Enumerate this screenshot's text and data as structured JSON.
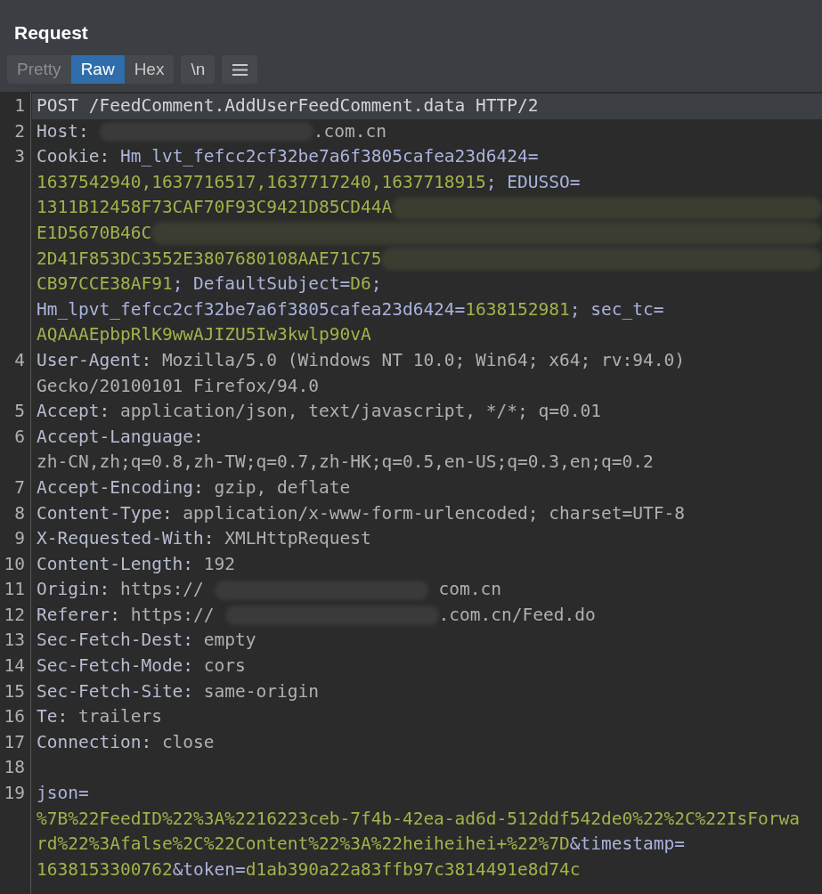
{
  "panel": {
    "title": "Request"
  },
  "tabs": [
    {
      "label": "Pretty",
      "selected": false,
      "disabled": true
    },
    {
      "label": "Raw",
      "selected": true,
      "disabled": false
    },
    {
      "label": "Hex",
      "selected": false,
      "disabled": false
    }
  ],
  "newline_toggle": {
    "label": "\\n"
  },
  "lines": [
    {
      "number": "1",
      "selected": true,
      "rows": [
        {
          "spans": [
            {
              "kind": "plain",
              "text": "POST /FeedComment.AddUserFeedComment.data HTTP/2"
            }
          ]
        }
      ]
    },
    {
      "number": "2",
      "selected": false,
      "rows": [
        {
          "spans": [
            {
              "kind": "name",
              "text": "Host:"
            },
            {
              "kind": "mask"
            },
            {
              "kind": "value",
              "text": ".com.cn"
            }
          ]
        }
      ]
    },
    {
      "number": "3",
      "selected": false,
      "rows": [
        {
          "spans": [
            {
              "kind": "name",
              "text": "Cookie:"
            },
            {
              "kind": "key",
              "text": " Hm_lvt_fefcc2cf32be7a6f3805cafea23d6424="
            }
          ]
        },
        {
          "spans": [
            {
              "kind": "green",
              "text": "1637542940,1637716517,1637717240,1637718915"
            },
            {
              "kind": "key",
              "text": "; EDUSSO="
            }
          ]
        },
        {
          "spans": [
            {
              "kind": "green",
              "text": "1311B12458F73CAF70F93C9421D85CD44A"
            },
            {
              "kind": "mask_wide"
            }
          ]
        },
        {
          "spans": [
            {
              "kind": "green",
              "text": "E1D5670B46C"
            },
            {
              "kind": "mask_wide"
            }
          ]
        },
        {
          "spans": [
            {
              "kind": "green",
              "text": "2D41F853DC3552E3807680108AAE71C75"
            },
            {
              "kind": "mask_wide"
            }
          ]
        },
        {
          "spans": [
            {
              "kind": "green",
              "text": "CB97CCE38AF91"
            },
            {
              "kind": "key",
              "text": "; DefaultSubject="
            },
            {
              "kind": "green",
              "text": "D6"
            },
            {
              "kind": "key",
              "text": ";"
            }
          ]
        },
        {
          "spans": [
            {
              "kind": "key",
              "text": "Hm_lpvt_fefcc2cf32be7a6f3805cafea23d6424="
            },
            {
              "kind": "green",
              "text": "1638152981"
            },
            {
              "kind": "key",
              "text": "; sec_tc="
            }
          ]
        },
        {
          "spans": [
            {
              "kind": "green",
              "text": "AQAAAEpbpRlK9wwAJIZU5Iw3kwlp90vA"
            }
          ]
        }
      ]
    },
    {
      "number": "4",
      "selected": false,
      "rows": [
        {
          "spans": [
            {
              "kind": "name",
              "text": "User-Agent:"
            },
            {
              "kind": "value",
              "text": " Mozilla/5.0 (Windows NT 10.0; Win64; x64; rv:94.0)"
            }
          ]
        },
        {
          "spans": [
            {
              "kind": "value",
              "text": "Gecko/20100101 Firefox/94.0"
            }
          ]
        }
      ]
    },
    {
      "number": "5",
      "selected": false,
      "rows": [
        {
          "spans": [
            {
              "kind": "name",
              "text": "Accept:"
            },
            {
              "kind": "value",
              "text": " application/json, text/javascript, */*; q=0.01"
            }
          ]
        }
      ]
    },
    {
      "number": "6",
      "selected": false,
      "rows": [
        {
          "spans": [
            {
              "kind": "name",
              "text": "Accept-Language:"
            }
          ]
        },
        {
          "spans": [
            {
              "kind": "value",
              "text": "zh-CN,zh;q=0.8,zh-TW;q=0.7,zh-HK;q=0.5,en-US;q=0.3,en;q=0.2"
            }
          ]
        }
      ]
    },
    {
      "number": "7",
      "selected": false,
      "rows": [
        {
          "spans": [
            {
              "kind": "name",
              "text": "Accept-Encoding:"
            },
            {
              "kind": "value",
              "text": " gzip, deflate"
            }
          ]
        }
      ]
    },
    {
      "number": "8",
      "selected": false,
      "rows": [
        {
          "spans": [
            {
              "kind": "name",
              "text": "Content-Type:"
            },
            {
              "kind": "value",
              "text": " application/x-www-form-urlencoded; charset=UTF-8"
            }
          ]
        }
      ]
    },
    {
      "number": "9",
      "selected": false,
      "rows": [
        {
          "spans": [
            {
              "kind": "name",
              "text": "X-Requested-With:"
            },
            {
              "kind": "value",
              "text": " XMLHttpRequest"
            }
          ]
        }
      ]
    },
    {
      "number": "10",
      "selected": false,
      "rows": [
        {
          "spans": [
            {
              "kind": "name",
              "text": "Content-Length:"
            },
            {
              "kind": "value",
              "text": " 192"
            }
          ]
        }
      ]
    },
    {
      "number": "11",
      "selected": false,
      "rows": [
        {
          "spans": [
            {
              "kind": "name",
              "text": "Origin:"
            },
            {
              "kind": "value",
              "text": " https://"
            },
            {
              "kind": "mask"
            },
            {
              "kind": "value",
              "text": " com.cn"
            }
          ]
        }
      ]
    },
    {
      "number": "12",
      "selected": false,
      "rows": [
        {
          "spans": [
            {
              "kind": "name",
              "text": "Referer:"
            },
            {
              "kind": "value",
              "text": " https://"
            },
            {
              "kind": "mask"
            },
            {
              "kind": "value",
              "text": ".com.cn/Feed.do"
            }
          ]
        }
      ]
    },
    {
      "number": "13",
      "selected": false,
      "rows": [
        {
          "spans": [
            {
              "kind": "name",
              "text": "Sec-Fetch-Dest:"
            },
            {
              "kind": "value",
              "text": " empty"
            }
          ]
        }
      ]
    },
    {
      "number": "14",
      "selected": false,
      "rows": [
        {
          "spans": [
            {
              "kind": "name",
              "text": "Sec-Fetch-Mode:"
            },
            {
              "kind": "value",
              "text": " cors"
            }
          ]
        }
      ]
    },
    {
      "number": "15",
      "selected": false,
      "rows": [
        {
          "spans": [
            {
              "kind": "name",
              "text": "Sec-Fetch-Site:"
            },
            {
              "kind": "value",
              "text": " same-origin"
            }
          ]
        }
      ]
    },
    {
      "number": "16",
      "selected": false,
      "rows": [
        {
          "spans": [
            {
              "kind": "name",
              "text": "Te:"
            },
            {
              "kind": "value",
              "text": " trailers"
            }
          ]
        }
      ]
    },
    {
      "number": "17",
      "selected": false,
      "rows": [
        {
          "spans": [
            {
              "kind": "name",
              "text": "Connection:"
            },
            {
              "kind": "value",
              "text": " close"
            }
          ]
        }
      ]
    },
    {
      "number": "18",
      "selected": false,
      "rows": [
        {
          "spans": []
        }
      ]
    },
    {
      "number": "19",
      "selected": false,
      "rows": [
        {
          "spans": [
            {
              "kind": "key",
              "text": "json="
            }
          ]
        },
        {
          "spans": [
            {
              "kind": "green",
              "text": "%7B%22FeedID%22%3A%2216223ceb-7f4b-42ea-ad6d-512ddf542de0%22%2C%22IsForwa"
            }
          ]
        },
        {
          "spans": [
            {
              "kind": "green",
              "text": "rd%22%3Afalse%2C%22Content%22%3A%22heiheihei+%22%7D"
            },
            {
              "kind": "key",
              "text": "&timestamp="
            }
          ]
        },
        {
          "spans": [
            {
              "kind": "green",
              "text": "1638153300762"
            },
            {
              "kind": "key",
              "text": "&token="
            },
            {
              "kind": "green",
              "text": "d1ab390a22a83ffb97c3814491e8d74c"
            }
          ]
        }
      ]
    }
  ]
}
